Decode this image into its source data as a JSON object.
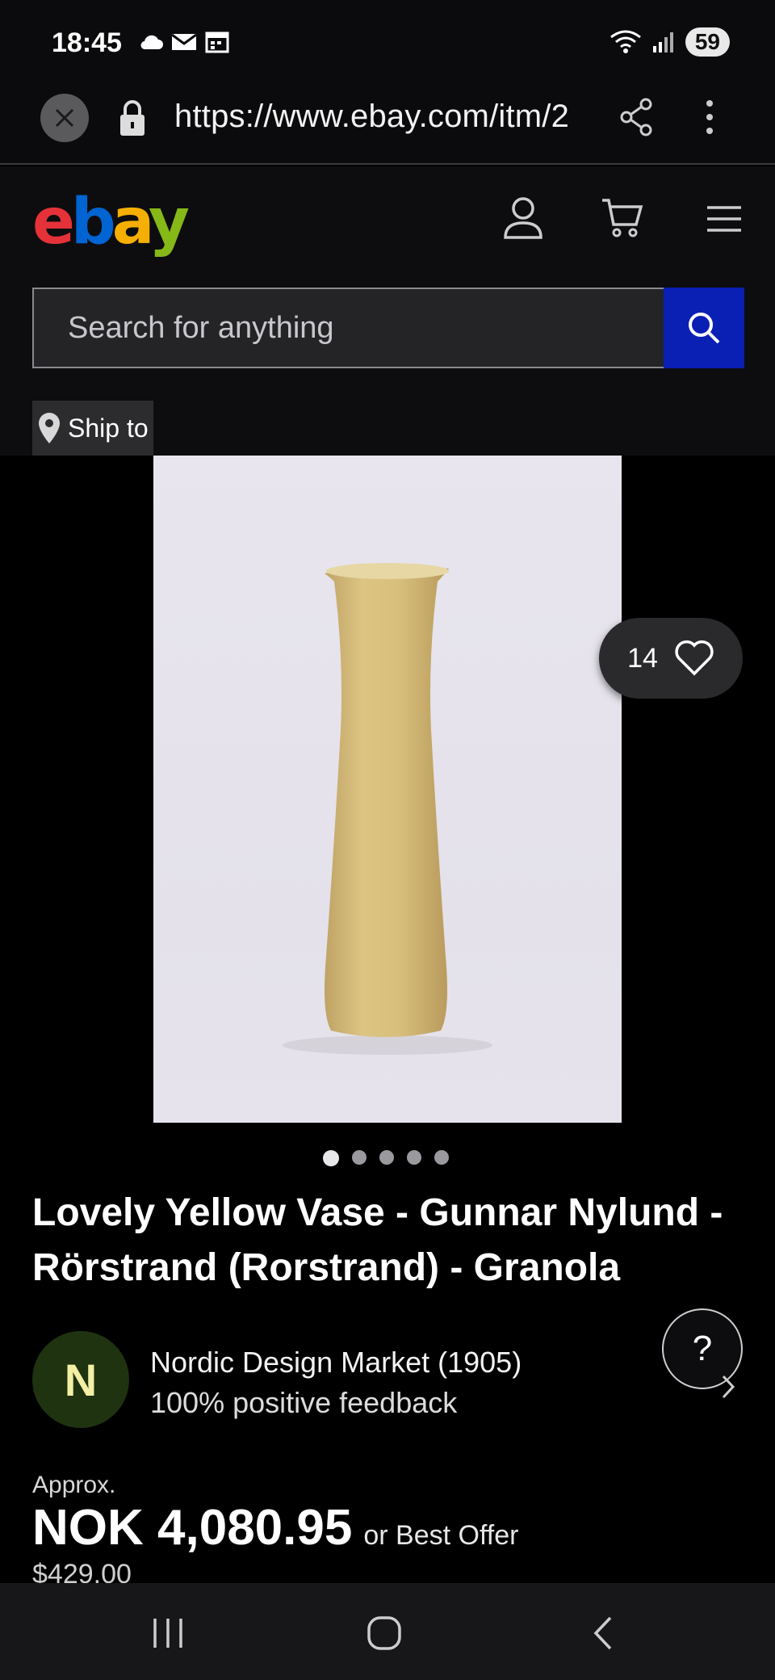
{
  "status_bar": {
    "time": "18:45",
    "battery": "59"
  },
  "browser": {
    "url": "https://www.ebay.com/itm/2"
  },
  "header": {
    "logo_letters": [
      "e",
      "b",
      "a",
      "y"
    ],
    "logo_colors": [
      "#e53238",
      "#0064d2",
      "#f5af02",
      "#86b817"
    ]
  },
  "search": {
    "placeholder": "Search for anything"
  },
  "ship_to": {
    "label": "Ship to"
  },
  "gallery": {
    "watch_count": "14",
    "image_count": 5,
    "active_index": 0
  },
  "product": {
    "title": "Lovely Yellow Vase - Gunnar Nylund - Rörstrand (Rorstrand) - Granola"
  },
  "seller": {
    "initial": "N",
    "name": "Nordic Design Market (1905)",
    "feedback": "100% positive feedback"
  },
  "help": {
    "label": "?"
  },
  "price": {
    "approx_label": "Approx.",
    "amount": "NOK 4,080.95",
    "offer": "or Best Offer",
    "usd": "$429.00"
  },
  "colors": {
    "accent_blue": "#0a1fb4",
    "background": "#000000"
  }
}
